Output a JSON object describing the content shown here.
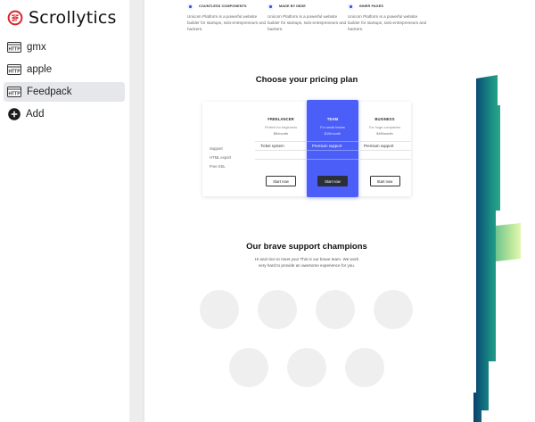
{
  "app": {
    "name": "Scrollytics",
    "logo_icon": "scrollytics-logo-icon",
    "accent": "#d8232a"
  },
  "sidebar": {
    "items": [
      {
        "label": "gmx",
        "icon": "http-icon",
        "active": false
      },
      {
        "label": "apple",
        "icon": "http-icon",
        "active": false
      },
      {
        "label": "Feedpack",
        "icon": "http-icon",
        "active": true
      }
    ],
    "add": {
      "label": "Add",
      "icon": "plus-circle-icon"
    }
  },
  "preview": {
    "features": [
      {
        "title": "COUNTLESS COMPONENTS",
        "desc": "Unicorn Platform is a powerful website builder for startups, solo-entrepreneurs and hackers.",
        "icon": "components-icon"
      },
      {
        "title": "MADE BY INDIE",
        "desc": "Unicorn Platform is a powerful website builder for startups, solo-entrepreneurs and hackers.",
        "icon": "indie-icon"
      },
      {
        "title": "INNER PAGES",
        "desc": "Unicorn Platform is a powerful website builder for startups, solo-entrepreneurs and hackers.",
        "icon": "pages-icon"
      }
    ],
    "pricing": {
      "title": "Choose your pricing plan",
      "feature_labels": [
        "Support",
        "HTML export",
        "Free SSL"
      ],
      "plans": [
        {
          "name": "FREELANCER",
          "sub": "Perfect for beginners",
          "price": "$9/month",
          "rows": [
            "Ticket system",
            "",
            ""
          ],
          "button": "Start now"
        },
        {
          "name": "TEAM",
          "sub": "For small teams",
          "price": "$19/month",
          "rows": [
            "Premium support",
            "",
            ""
          ],
          "button": "Start now",
          "highlight_color": "#4b5ef8"
        },
        {
          "name": "BUSINESS",
          "sub": "For huge companies",
          "price": "$49/month",
          "rows": [
            "Premium support",
            "",
            ""
          ],
          "button": "Start now"
        }
      ]
    },
    "support": {
      "title": "Our brave support champions",
      "desc": "Hi and nice to meet you! This is our brave team. We work very hard to provide an awesome experience for you.",
      "avatar_count": 7
    }
  }
}
